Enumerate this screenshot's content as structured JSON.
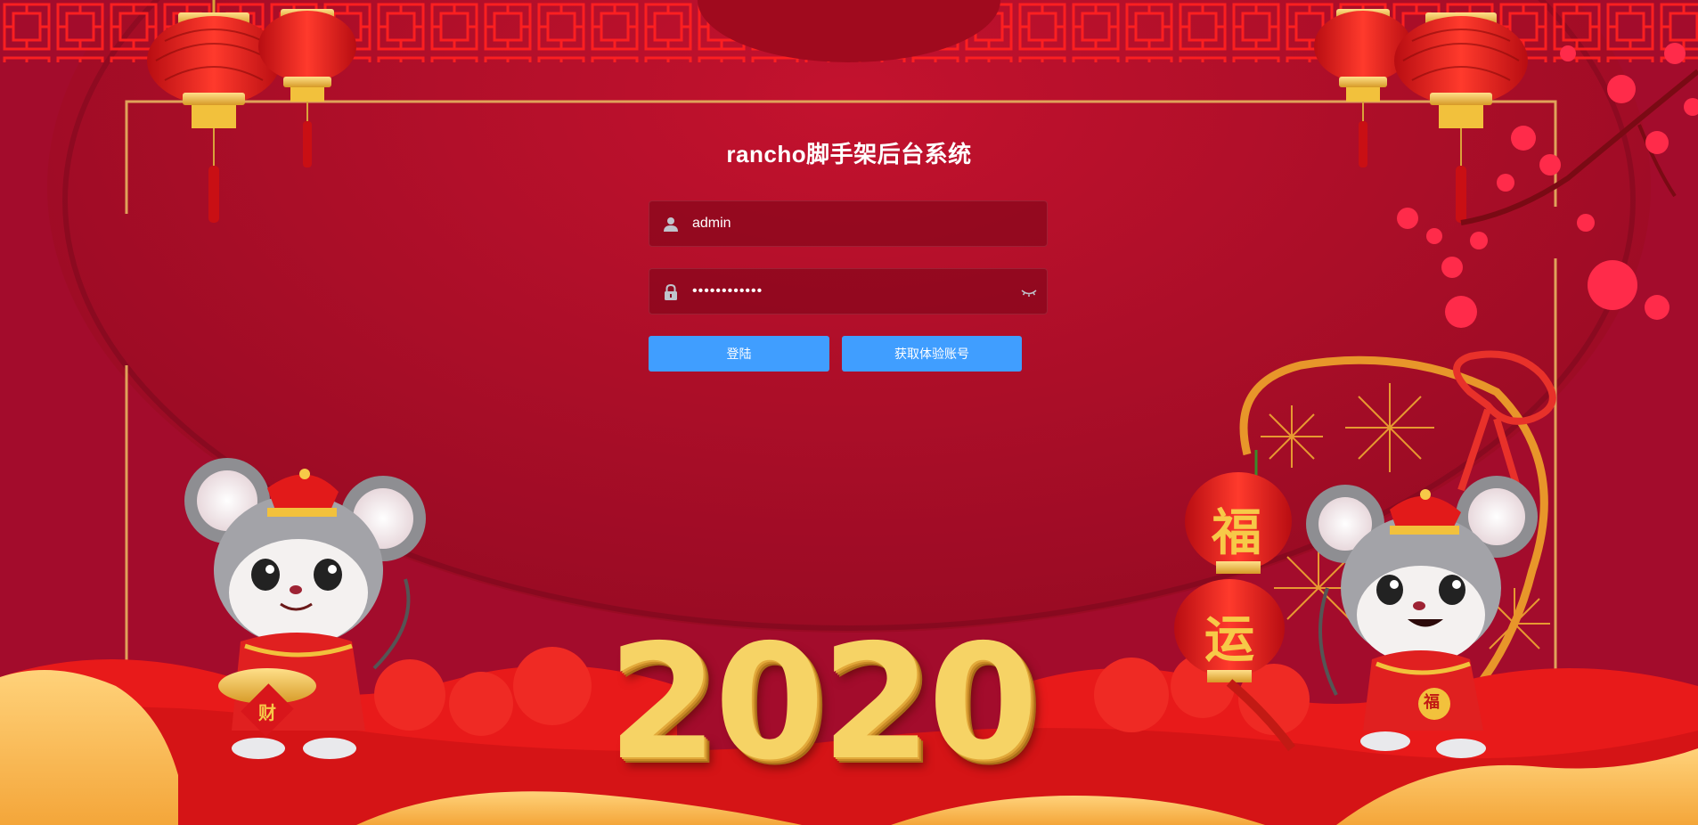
{
  "login": {
    "title": "rancho脚手架后台系统",
    "username": {
      "value": "admin",
      "icon": "user-icon"
    },
    "password": {
      "value": "••••••••••••",
      "icon": "lock-icon",
      "toggle_icon": "eye-closed-icon"
    },
    "buttons": {
      "login_label": "登陆",
      "trial_label": "获取体验账号"
    }
  },
  "decor": {
    "year": "2020",
    "lantern_top_char": "福",
    "lantern_bottom_char": "运",
    "rat_left_badge": "财",
    "rat_right_badge": "福"
  },
  "colors": {
    "background": "#a40c26",
    "frame": "#e0a25a",
    "button": "#409eff",
    "text": "#ffffff",
    "gold": "#f6d365"
  }
}
